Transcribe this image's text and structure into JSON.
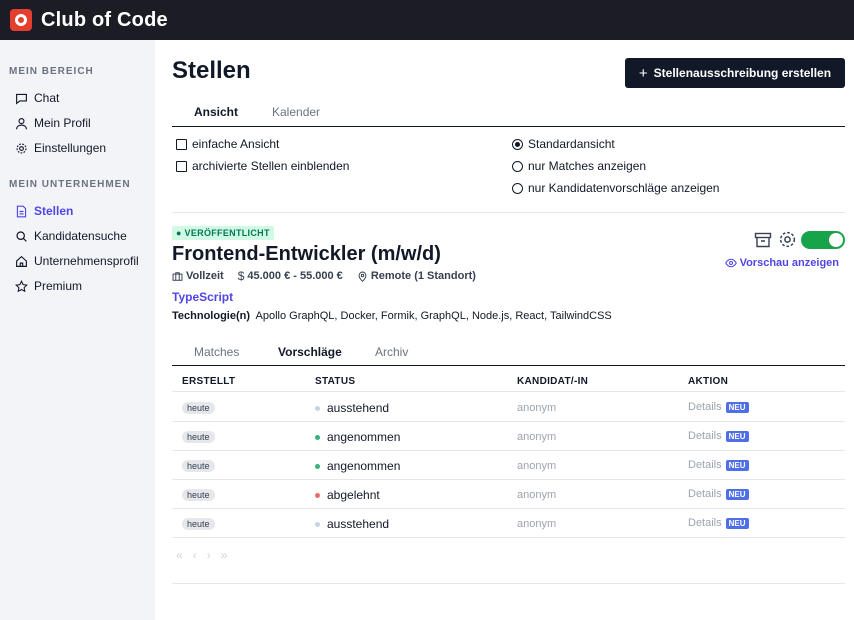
{
  "app": {
    "title": "Club of Code"
  },
  "sidebar": {
    "section1": "MEIN BEREICH",
    "section2": "MEIN UNTERNEHMEN",
    "items": [
      {
        "label": "Chat",
        "icon": "chat-icon"
      },
      {
        "label": "Mein Profil",
        "icon": "user-icon"
      },
      {
        "label": "Einstellungen",
        "icon": "gear-icon"
      },
      {
        "label": "Stellen",
        "icon": "document-icon",
        "active": true
      },
      {
        "label": "Kandidatensuche",
        "icon": "search-icon"
      },
      {
        "label": "Unternehmensprofil",
        "icon": "home-icon"
      },
      {
        "label": "Premium",
        "icon": "star-icon"
      }
    ]
  },
  "page": {
    "title": "Stellen",
    "create_button": "Stellenausschreibung erstellen"
  },
  "view_tabs": [
    {
      "label": "Ansicht",
      "active": true
    },
    {
      "label": "Kalender",
      "active": false
    }
  ],
  "options": {
    "checkboxes": [
      {
        "label": "einfache Ansicht",
        "checked": false
      },
      {
        "label": "archivierte Stellen einblenden",
        "checked": false
      }
    ],
    "radios": [
      {
        "label": "Standardansicht",
        "selected": true
      },
      {
        "label": "nur Matches anzeigen",
        "selected": false
      },
      {
        "label": "nur Kandidatenvorschläge anzeigen",
        "selected": false
      }
    ]
  },
  "job": {
    "status_badge": "VERÖFFENTLICHT",
    "title": "Frontend-Entwickler (m/w/d)",
    "employment": "Vollzeit",
    "salary": "45.000 € - 55.000 €",
    "location": "Remote (1 Standort)",
    "main_skill": "TypeScript",
    "tech_label": "Technologie(n)",
    "tech_list": "Apollo GraphQL, Docker, Formik, GraphQL, Node.js, React, TailwindCSS",
    "preview_label": "Vorschau anzeigen",
    "published_toggle_on": true,
    "colors": {
      "published": "#16a34a",
      "accent": "#4f46e5"
    }
  },
  "job_tabs": [
    {
      "label": "Matches",
      "active": false
    },
    {
      "label": "Vorschläge",
      "active": true
    },
    {
      "label": "Archiv",
      "active": false
    }
  ],
  "table": {
    "headers": [
      "ERSTELLT",
      "STATUS",
      "KANDIDAT/-IN",
      "AKTION"
    ],
    "rows": [
      {
        "date": "heute",
        "status": "ausstehend",
        "status_color": "#c7d2e6",
        "candidate": "anonym",
        "action": "Details",
        "badge": "NEU"
      },
      {
        "date": "heute",
        "status": "angenommen",
        "status_color": "#34b37a",
        "candidate": "anonym",
        "action": "Details",
        "badge": "NEU"
      },
      {
        "date": "heute",
        "status": "angenommen",
        "status_color": "#34b37a",
        "candidate": "anonym",
        "action": "Details",
        "badge": "NEU"
      },
      {
        "date": "heute",
        "status": "abgelehnt",
        "status_color": "#ef6b6b",
        "candidate": "anonym",
        "action": "Details",
        "badge": "NEU"
      },
      {
        "date": "heute",
        "status": "ausstehend",
        "status_color": "#c7d2e6",
        "candidate": "anonym",
        "action": "Details",
        "badge": "NEU"
      }
    ]
  },
  "pagination": {
    "first": "«",
    "prev": "‹",
    "next": "›",
    "last": "»"
  }
}
